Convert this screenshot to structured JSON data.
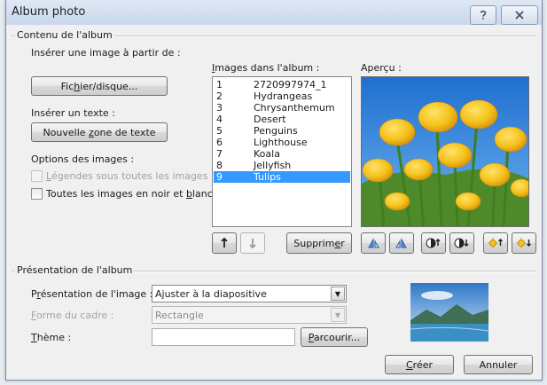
{
  "window": {
    "title": "Album photo",
    "help_icon": "help-icon",
    "close_icon": "close-icon"
  },
  "album": {
    "group_label": "Contenu de l'album",
    "insert_image_label": "Insérer une image à partir de :",
    "file_button_label": "Fichier/disque...",
    "insert_text_label": "Insérer un texte :",
    "new_textbox_button_label": "Nouvelle zone de texte",
    "image_options_label": "Options des images :",
    "captions_checkbox_label": "Légendes sous toutes les images",
    "captions_checked": false,
    "grayscale_checkbox_label": "Toutes les images en noir et blanc",
    "grayscale_checked": false,
    "images_list_label": "Images dans l'album :",
    "images": [
      {
        "num": "1",
        "name": "2720997974_1"
      },
      {
        "num": "2",
        "name": "Hydrangeas"
      },
      {
        "num": "3",
        "name": "Chrysanthemum"
      },
      {
        "num": "4",
        "name": "Desert"
      },
      {
        "num": "5",
        "name": "Penguins"
      },
      {
        "num": "6",
        "name": "Lighthouse"
      },
      {
        "num": "7",
        "name": "Koala"
      },
      {
        "num": "8",
        "name": "Jellyfish"
      },
      {
        "num": "9",
        "name": "Tulips"
      }
    ],
    "selected_index": 8,
    "preview_label": "Aperçu :",
    "move_up_icon": "arrow-up-icon",
    "move_down_icon": "arrow-down-icon",
    "delete_button_label": "Supprimer",
    "preview_tools": [
      "rotate-left-icon",
      "rotate-right-icon",
      "contrast-increase-icon",
      "contrast-decrease-icon",
      "brightness-increase-icon",
      "brightness-decrease-icon"
    ]
  },
  "layout_section": {
    "group_label": "Présentation de l'album",
    "picture_layout_label": "Présentation de l'image :",
    "picture_layout_value": "Ajuster à la diapositive",
    "frame_shape_label": "Forme du cadre :",
    "frame_shape_value": "Rectangle",
    "theme_label": "Thème :",
    "theme_value": "",
    "browse_button_label": "Parcourir..."
  },
  "footer": {
    "create_button_label": "Créer",
    "cancel_button_label": "Annuler"
  },
  "colors": {
    "selection": "#3399ff",
    "sky": "#3a7cc9",
    "tulip": "#f5c21b"
  }
}
